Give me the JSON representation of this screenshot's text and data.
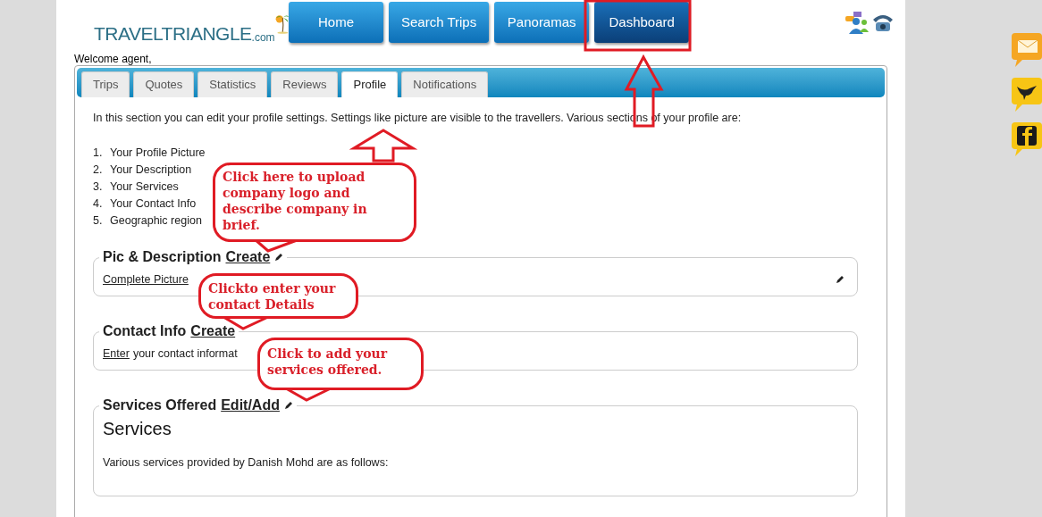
{
  "logo": {
    "name": "TRAVELTRIANGLE",
    "suffix": ".com"
  },
  "nav": [
    {
      "label": "Home",
      "selected": false
    },
    {
      "label": "Search Trips",
      "selected": false
    },
    {
      "label": "Panoramas",
      "selected": false
    },
    {
      "label": "Dashboard",
      "selected": true
    }
  ],
  "welcome": "Welcome agent,",
  "tabs": [
    {
      "label": "Trips",
      "selected": false
    },
    {
      "label": "Quotes",
      "selected": false
    },
    {
      "label": "Statistics",
      "selected": false
    },
    {
      "label": "Reviews",
      "selected": false
    },
    {
      "label": "Profile",
      "selected": true
    },
    {
      "label": "Notifications",
      "selected": false
    }
  ],
  "intro": "In this section you can edit your profile settings. Settings like picture are visible to the travellers. Various sections of your profile are:",
  "profile_sections": [
    {
      "number": "1.",
      "text": "Your Profile Picture"
    },
    {
      "number": "2.",
      "text": "Your Description"
    },
    {
      "number": "3.",
      "text": "Your Services"
    },
    {
      "number": "4.",
      "text": "Your Contact Info"
    },
    {
      "number": "5.",
      "text": "Geographic region"
    }
  ],
  "sections": [
    {
      "kind": "pic",
      "title": "Pic & Description",
      "action": "Create",
      "edit_icon": true,
      "body_link": "Complete Picture"
    },
    {
      "kind": "contact",
      "title": "Contact Info",
      "action": "Create",
      "edit_icon": false,
      "body_link": "Enter",
      "body_text": "your contact informat"
    },
    {
      "kind": "services",
      "title": "Services Offered",
      "action": "Edit/Add",
      "edit_icon": true,
      "heading": "Services",
      "body_text": "Various services provided by Danish Mohd are as follows:"
    }
  ],
  "callouts": [
    {
      "text": "Click here to upload company logo and describe company in brief."
    },
    {
      "text": "Clickto enter your contact Details"
    },
    {
      "text": "Click to add your services offered."
    }
  ]
}
